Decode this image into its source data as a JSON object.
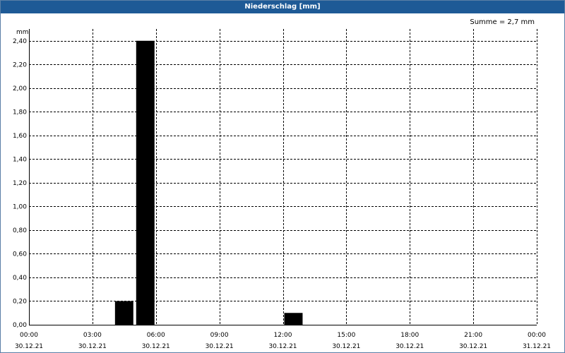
{
  "window": {
    "title": "Niederschlag [mm]"
  },
  "chart_data": {
    "type": "bar",
    "title": "Niederschlag [mm]",
    "annotation": "Summe = 2,7 mm",
    "ylabel": "mm",
    "ylim": [
      0,
      2.5
    ],
    "yticks": [
      0,
      0.2,
      0.4,
      0.6,
      0.8,
      1.0,
      1.2,
      1.4,
      1.6,
      1.8,
      2.0,
      2.2,
      2.4
    ],
    "ytick_labels": [
      "0,00",
      "0,20",
      "0,40",
      "0,60",
      "0,80",
      "1,00",
      "1,20",
      "1,40",
      "1,60",
      "1,80",
      "2,00",
      "2,20",
      "2,40"
    ],
    "xlim_hours": [
      0,
      24
    ],
    "xticks_hours": [
      0,
      3,
      6,
      9,
      12,
      15,
      18,
      21,
      24
    ],
    "xtick_labels": [
      [
        "00:00",
        "30.12.21"
      ],
      [
        "03:00",
        "30.12.21"
      ],
      [
        "06:00",
        "30.12.21"
      ],
      [
        "09:00",
        "30.12.21"
      ],
      [
        "12:00",
        "30.12.21"
      ],
      [
        "15:00",
        "30.12.21"
      ],
      [
        "18:00",
        "30.12.21"
      ],
      [
        "21:00",
        "30.12.21"
      ],
      [
        "00:00",
        "31.12.21"
      ]
    ],
    "grid": true,
    "series": [
      {
        "bars": [
          {
            "start": "04:00",
            "end": "05:00",
            "value": 0.2
          },
          {
            "start": "05:00",
            "end": "06:00",
            "value": 2.4
          },
          {
            "start": "12:00",
            "end": "13:00",
            "value": 0.1
          }
        ]
      }
    ],
    "colors": {
      "bar": "#000000",
      "grid": "#000000",
      "title_bg": "#1e5a96"
    }
  }
}
